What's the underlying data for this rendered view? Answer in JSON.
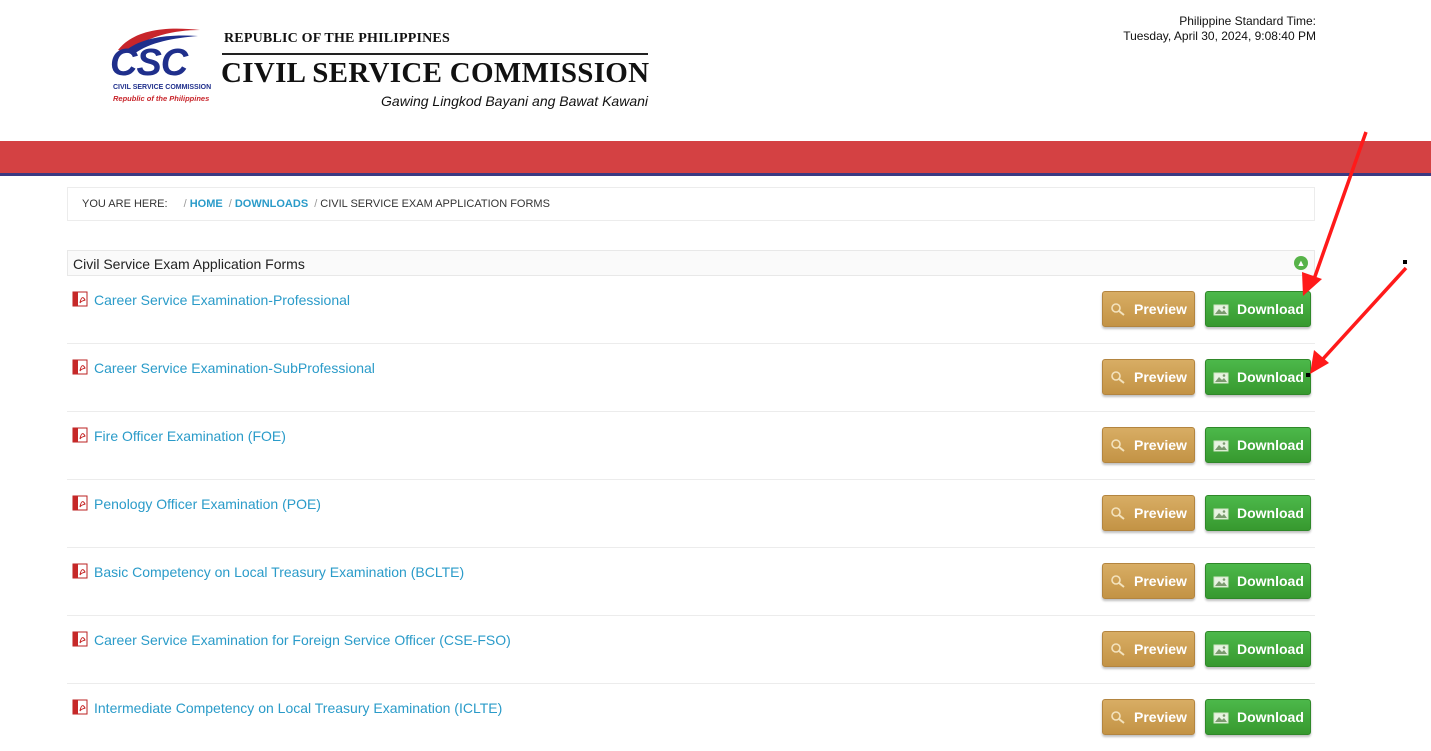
{
  "header": {
    "logo_text": "CSC",
    "logo_sub1": "CIVIL SERVICE COMMISSION",
    "logo_sub2": "Republic of the Philippines",
    "republic": "REPUBLIC OF THE PHILIPPINES",
    "agency": "CIVIL SERVICE COMMISSION",
    "motto": "Gawing Lingkod Bayani ang Bawat Kawani",
    "time_label": "Philippine Standard Time:",
    "time_value": "Tuesday, April 30, 2024, 9:08:40 PM"
  },
  "breadcrumb": {
    "label": "YOU ARE HERE:",
    "home": "HOME",
    "downloads": "DOWNLOADS",
    "current": "CIVIL SERVICE EXAM APPLICATION FORMS"
  },
  "section": {
    "title": "Civil Service Exam Application Forms"
  },
  "buttons": {
    "preview": "Preview",
    "download": "Download"
  },
  "forms": [
    {
      "title": "Career Service Examination-Professional"
    },
    {
      "title": "Career Service Examination-SubProfessional"
    },
    {
      "title": "Fire Officer Examination (FOE)"
    },
    {
      "title": "Penology Officer Examination (POE)"
    },
    {
      "title": "Basic Competency on Local Treasury Examination (BCLTE)"
    },
    {
      "title": "Career Service Examination for Foreign Service Officer (CSE-FSO)"
    },
    {
      "title": "Intermediate Competency on Local Treasury Examination (ICLTE)"
    }
  ],
  "colors": {
    "band": "#d44143",
    "band_line": "#3b3a82",
    "link": "#2a9bc9",
    "preview": "#c8994b",
    "download": "#3ea83a",
    "arrow": "#ff1a1a"
  }
}
